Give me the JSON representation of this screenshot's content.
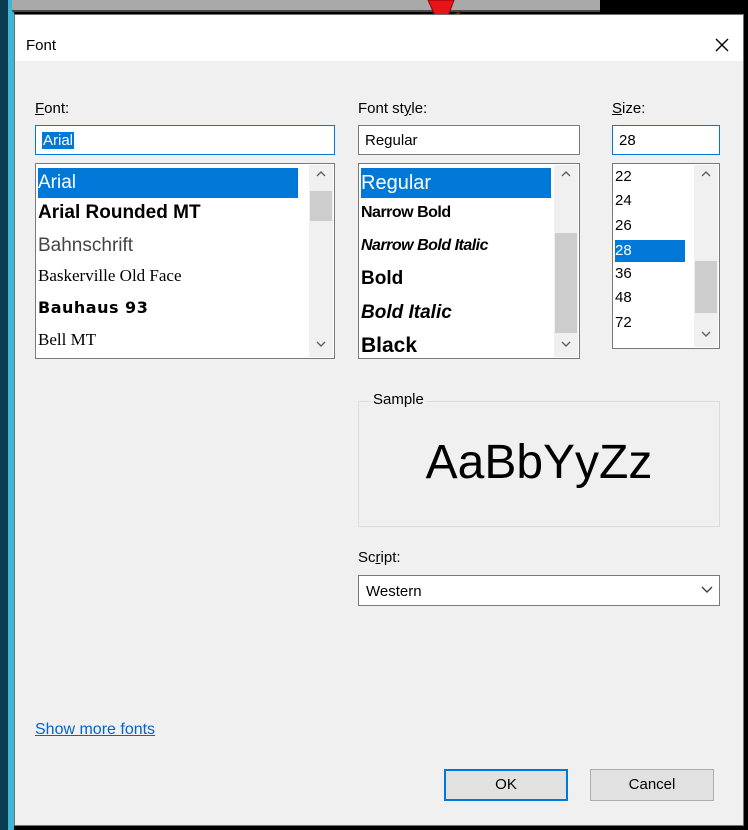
{
  "dialog": {
    "title": "Font",
    "close_label": "✕"
  },
  "font_column": {
    "label_underlined": "F",
    "label_rest": "ont:",
    "input_value": "Arial",
    "items": [
      "Arial",
      "Arial Rounded MT",
      "Bahnschrift",
      "Baskerville Old Face",
      "Bauhaus 93",
      "Bell MT"
    ],
    "selected": "Arial"
  },
  "style_column": {
    "label_pre": "Font st",
    "label_underlined": "y",
    "label_rest": "le:",
    "input_value": "Regular",
    "items": [
      "Regular",
      "Narrow Bold",
      "Narrow Bold Italic",
      "Bold",
      "Bold Italic",
      "Black"
    ],
    "selected": "Regular"
  },
  "size_column": {
    "label_underlined": "S",
    "label_rest": "ize:",
    "input_value": "28",
    "items": [
      "22",
      "24",
      "26",
      "28",
      "36",
      "48",
      "72"
    ],
    "selected": "28"
  },
  "sample": {
    "title": "Sample",
    "text": "AaBbYyZz"
  },
  "script": {
    "label_pre": "Sc",
    "label_underlined": "r",
    "label_rest": "ipt:",
    "value": "Western"
  },
  "show_more_link": "Show more fonts",
  "buttons": {
    "ok": "OK",
    "cancel": "Cancel"
  },
  "colors": {
    "accent": "#0078d7",
    "arrow": "#e8141b",
    "link": "#0066cc"
  },
  "icons": {
    "close": "close-icon",
    "chevron_up": "chevron-up-icon",
    "chevron_down": "chevron-down-icon"
  }
}
